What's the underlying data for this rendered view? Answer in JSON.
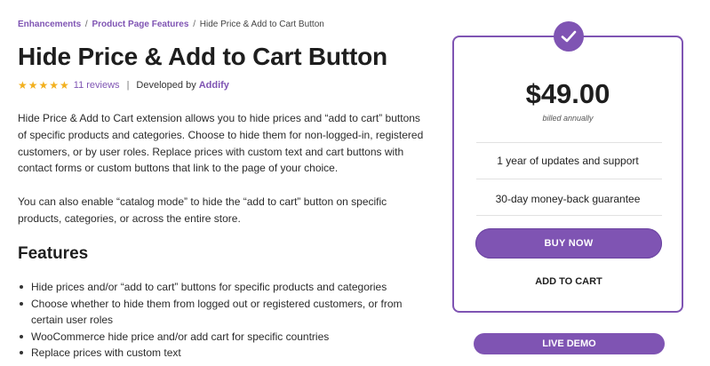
{
  "breadcrumb": {
    "items": [
      "Enhancements",
      "Product Page Features",
      "Hide Price & Add to Cart Button"
    ],
    "separator": "/"
  },
  "product": {
    "title": "Hide Price & Add to Cart Button",
    "rating_stars": 5,
    "stars_text": "★★★★★",
    "reviews_label": "11 reviews",
    "meta_divider": "|",
    "developed_by_label": "Developed by",
    "developer": "Addify"
  },
  "description": {
    "paragraph1": "Hide Price & Add to Cart extension allows you to hide prices and “add to cart” buttons of specific products and categories. Choose to hide them for non-logged-in, registered customers, or by user roles. Replace prices with custom text and cart buttons with contact forms or custom buttons that link to the page of your choice.",
    "paragraph2": "You can also enable “catalog mode” to hide the “add to cart” button on specific products, categories, or across the entire store."
  },
  "features": {
    "heading": "Features",
    "items": [
      "Hide prices and/or “add to cart” buttons for specific products and categories",
      "Choose whether to hide them from logged out or registered customers, or from certain user roles",
      "WooCommerce hide price and/or add cart for specific countries",
      "Replace prices with custom text"
    ]
  },
  "pricing": {
    "price": "$49.00",
    "billing": "billed annually",
    "line1": "1 year of updates and support",
    "line2": "30-day money-back guarantee",
    "buy_now": "BUY NOW",
    "add_to_cart": "ADD TO CART",
    "live_demo": "LIVE DEMO",
    "icon": "checkmark-icon"
  },
  "colors": {
    "accent": "#7f54b3",
    "star": "#f2b01e",
    "text": "#1e1e1e"
  }
}
